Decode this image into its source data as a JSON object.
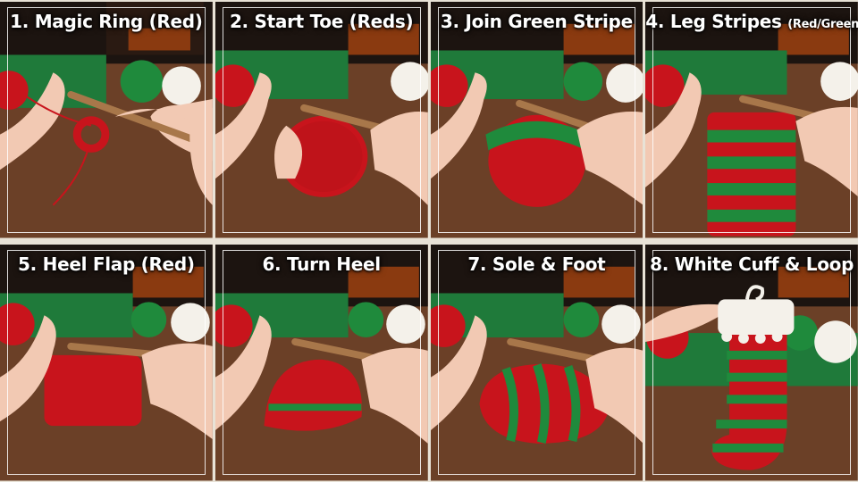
{
  "panels": [
    {
      "step": "1.",
      "title": "Magic Ring (Red)",
      "note": ""
    },
    {
      "step": "2.",
      "title": "Start Toe (Reds)",
      "note": ""
    },
    {
      "step": "3.",
      "title": "Join Green Stripe",
      "note": ""
    },
    {
      "step": "4.",
      "title": "Leg Stripes",
      "note": "(Red/Green)"
    },
    {
      "step": "5.",
      "title": "Heel Flap (Red)",
      "note": ""
    },
    {
      "step": "6.",
      "title": "Turn Heel",
      "note": ""
    },
    {
      "step": "7.",
      "title": "Sole & Foot",
      "note": ""
    },
    {
      "step": "8.",
      "title": "White Cuff & Loop",
      "note": ""
    }
  ],
  "colors": {
    "wood": "#7a4a2c",
    "felt_green": "#1f7a3a",
    "yarn_red": "#c8141c",
    "yarn_green": "#1f8a3c",
    "yarn_white": "#f4f1ea",
    "hook": "#a8774a",
    "skin": "#f2c9b3"
  }
}
